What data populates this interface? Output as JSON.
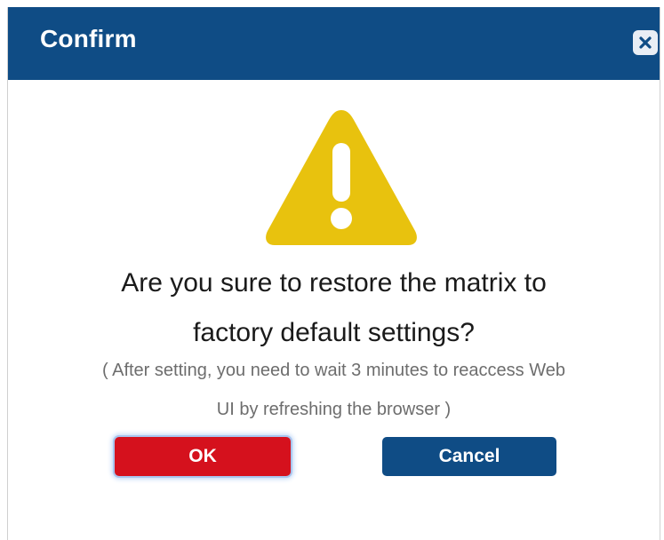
{
  "dialog": {
    "title": "Confirm",
    "close_icon": "close-icon",
    "warning_icon": "warning-triangle-icon",
    "question_line1": "Are you sure to restore the matrix to",
    "question_line2": "factory default settings?",
    "note_line1": "( After setting, you need to wait 3 minutes to reaccess Web",
    "note_line2": "UI by refreshing the browser )",
    "ok_label": "OK",
    "cancel_label": "Cancel"
  },
  "colors": {
    "titlebar": "#0f4c85",
    "warning": "#e8c20e",
    "ok_button": "#d5111d",
    "cancel_button": "#0f4c85"
  }
}
